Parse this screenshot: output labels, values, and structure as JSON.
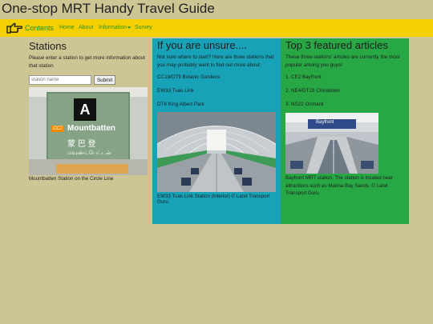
{
  "site": {
    "title": "One-stop MRT Handy Travel Guide"
  },
  "nav": {
    "brand": "Contents",
    "home": "Home",
    "about": "About",
    "information": "Information",
    "survey": "Survey"
  },
  "stations": {
    "heading": "Stations",
    "intro": "Please enter a station to get more information about that station",
    "search_placeholder": "station name",
    "submit_label": "Submit",
    "sign_letter": "A",
    "sign_code": "CC7",
    "sign_name": "Mountbatten",
    "sign_chinese": "蒙 巴 登",
    "sign_tamil": "மவுண்ட்பேட்டன்",
    "caption": "Mountbatten Station on the Circle Line"
  },
  "unsure": {
    "heading": "If you are unsure....",
    "intro": "Not sure where to start? Here are three stations that you may probably want to find out more about:",
    "links": [
      "CC19/DT9 Botanic Gardens",
      "EW33 Tuas Link",
      "DT6 King Albert Park"
    ],
    "caption": "EW33 Tuas Link Station (interior) © Land Transport Guru"
  },
  "featured": {
    "heading": "Top 3 featured articles",
    "intro": "These three stations' articles are currently the most popular among you guys!",
    "items": [
      "1. CE2 Bayfront",
      "2. NE4/DT19 Chinatown",
      "3. NS22 Orchard"
    ],
    "sign_text": "Bayfront",
    "caption": "Bayfront MRT station. The station is located near attractions such as Marina Bay Sands. © Land Transport Guru"
  }
}
